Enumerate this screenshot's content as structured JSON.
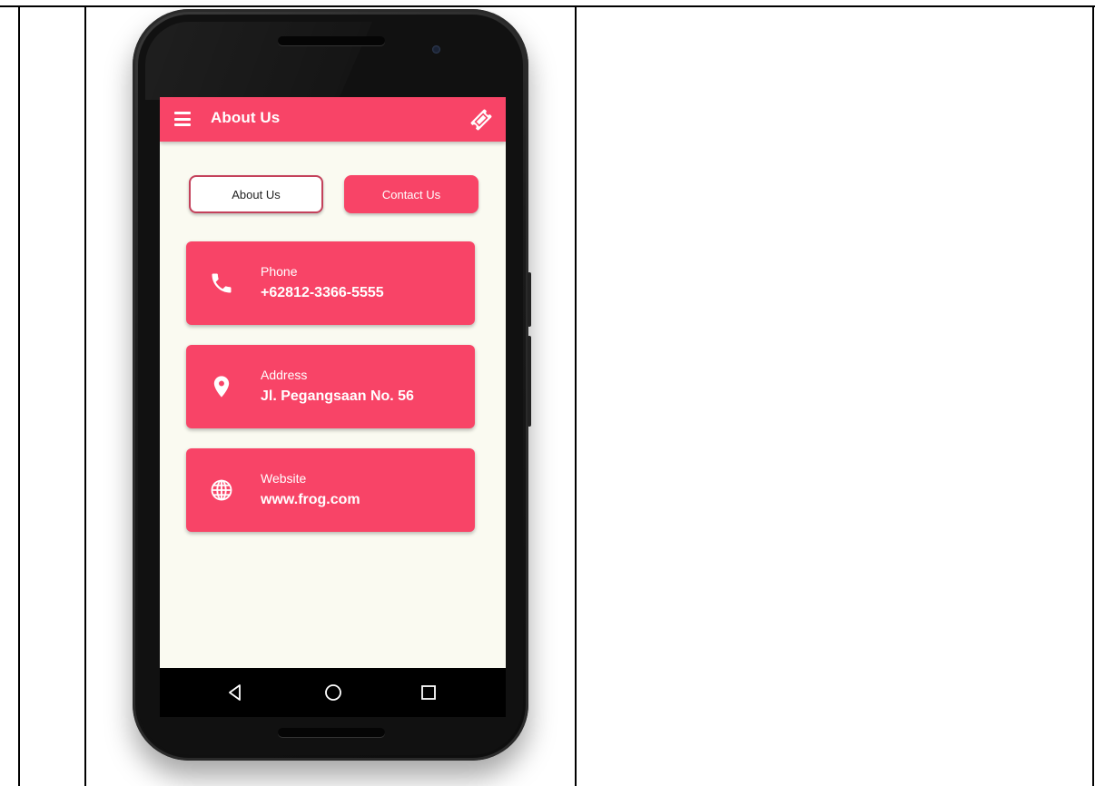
{
  "app": {
    "title": "About Us"
  },
  "tabs": {
    "about_label": "About Us",
    "contact_label": "Contact Us",
    "active": "about"
  },
  "cards": [
    {
      "icon": "phone-icon",
      "label": "Phone",
      "value": "+62812-3366-5555"
    },
    {
      "icon": "location-pin-icon",
      "label": "Address",
      "value": "Jl. Pegangsaan No. 56"
    },
    {
      "icon": "globe-icon",
      "label": "Website",
      "value": "www.frog.com"
    }
  ],
  "navbar": {
    "items": [
      "back-icon",
      "home-icon",
      "recents-icon"
    ]
  },
  "colors": {
    "accent": "#f84467",
    "background": "#fafaf1",
    "tab_border": "#c4415b"
  }
}
